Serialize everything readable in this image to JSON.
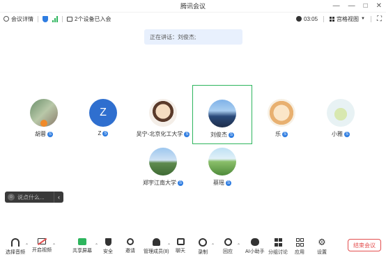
{
  "window": {
    "title": "腾讯会议"
  },
  "topbar": {
    "meeting_details": "会议详情",
    "devices": "2个设备已入会",
    "timer": "03:05",
    "view_mode": "宫格视图"
  },
  "speaker_banner": "正在讲话：刘俊杰;",
  "participants": [
    {
      "name": "胡蓉"
    },
    {
      "name": "Z",
      "initial": "Z"
    },
    {
      "name": "吴宁-北京化工大学"
    },
    {
      "name": "刘俊杰"
    },
    {
      "name": "乐"
    },
    {
      "name": "小雅"
    },
    {
      "name": "郑宇江南大学"
    },
    {
      "name": "蔡瑶"
    }
  ],
  "badge_letter": "S",
  "chat": {
    "placeholder": "说点什么..."
  },
  "toolbar": {
    "audio": "选择音频",
    "video": "开启视频",
    "share": "共享屏幕",
    "security": "安全",
    "invite": "邀请",
    "members": "管理成员(8)",
    "chat": "聊天",
    "record": "录制",
    "apps_flow": "回应",
    "ai": "AI小助手",
    "breakout": "分组讨论",
    "apps": "应用",
    "settings": "设置",
    "end": "结束会议"
  },
  "colors": {
    "accent": "#2f7de1",
    "active_border": "#2db55d",
    "end": "#e34d4d",
    "z_avatar": "#2f6fcf"
  }
}
